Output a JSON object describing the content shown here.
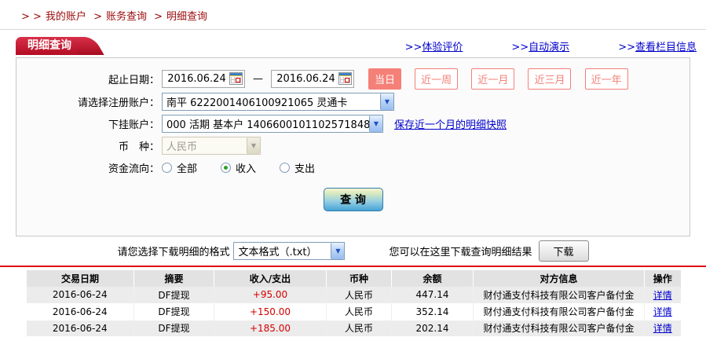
{
  "breadcrumb": {
    "items": [
      {
        "sep": "> >",
        "label": "我的账户"
      },
      {
        "sep": ">",
        "label": "账务查询"
      },
      {
        "sep": ">",
        "label": "明细查询"
      }
    ]
  },
  "header": {
    "tab": "明细查询",
    "links": [
      {
        "prefix": ">>",
        "label": "体验评价"
      },
      {
        "prefix": ">>",
        "label": "自动演示"
      },
      {
        "prefix": ">>",
        "label": "查看栏目信息"
      }
    ]
  },
  "form": {
    "date_label": "起止日期：",
    "date_from": "2016.06.24",
    "date_to": "2016.06.24",
    "date_dash": "—",
    "quick_buttons": [
      {
        "label": "当日",
        "active": true
      },
      {
        "label": "近一周",
        "active": false
      },
      {
        "label": "近一月",
        "active": false
      },
      {
        "label": "近三月",
        "active": false
      },
      {
        "label": "近一年",
        "active": false
      }
    ],
    "account_label": "请选择注册账户：",
    "account_value": "南平 6222001406100921065 灵通卡",
    "sub_account_label": "下挂账户：",
    "sub_account_value": "000 活期 基本户 1406600101102571848",
    "snapshot_link": "保存近一个月的明细快照",
    "currency_label": "币　种：",
    "currency_value": "人民币",
    "flow_label": "资金流向：",
    "flow_options": [
      {
        "label": "全部",
        "checked": false
      },
      {
        "label": "收入",
        "checked": true
      },
      {
        "label": "支出",
        "checked": false
      }
    ],
    "query_button": "查 询"
  },
  "download": {
    "format_label": "请您选择下载明细的格式",
    "format_value": "文本格式（.txt）",
    "hint": "您可以在这里下载查询明细结果",
    "button": "下载"
  },
  "table": {
    "headers": [
      "交易日期",
      "摘要",
      "收入/支出",
      "币种",
      "余额",
      "对方信息",
      "操作"
    ],
    "rows": [
      {
        "date": "2016-06-24",
        "summary": "DF提现",
        "amount": "+95.00",
        "currency": "人民币",
        "balance": "447.14",
        "counterparty": "财付通支付科技有限公司客户备付金",
        "action": "详情"
      },
      {
        "date": "2016-06-24",
        "summary": "DF提现",
        "amount": "+150.00",
        "currency": "人民币",
        "balance": "352.14",
        "counterparty": "财付通支付科技有限公司客户备付金",
        "action": "详情"
      },
      {
        "date": "2016-06-24",
        "summary": "DF提现",
        "amount": "+185.00",
        "currency": "人民币",
        "balance": "202.14",
        "counterparty": "财付通支付科技有限公司客户备付金",
        "action": "详情"
      }
    ]
  },
  "icons": {
    "dropdown_arrow": "▼"
  },
  "colors": {
    "breadcrumb_red": "#9b0b0b",
    "accent_red": "#c1122f",
    "link_blue": "#0000cc",
    "amount_red": "#d40000",
    "salmon": "#f48078",
    "rule_red": "#dd1111"
  }
}
